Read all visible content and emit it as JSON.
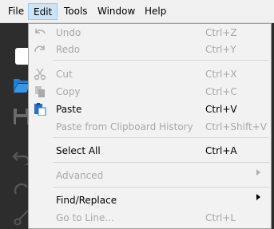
{
  "menubar": {
    "items": [
      {
        "label": "File"
      },
      {
        "label": "Edit"
      },
      {
        "label": "Tools"
      },
      {
        "label": "Window"
      },
      {
        "label": "Help"
      }
    ]
  },
  "edit_menu": {
    "items": [
      {
        "label": "Undo",
        "shortcut": "Ctrl+Z",
        "enabled": false,
        "icon": "undo-icon"
      },
      {
        "label": "Redo",
        "shortcut": "Ctrl+Y",
        "enabled": false,
        "icon": "redo-icon"
      },
      {
        "label": "Cut",
        "shortcut": "Ctrl+X",
        "enabled": false,
        "icon": "scissors-icon"
      },
      {
        "label": "Copy",
        "shortcut": "Ctrl+C",
        "enabled": false,
        "icon": "copy-icon"
      },
      {
        "label": "Paste",
        "shortcut": "Ctrl+V",
        "enabled": true,
        "icon": "paste-icon"
      },
      {
        "label": "Paste from Clipboard History",
        "shortcut": "Ctrl+Shift+V",
        "enabled": false
      },
      {
        "label": "Select All",
        "shortcut": "Ctrl+A",
        "enabled": true
      },
      {
        "label": "Advanced",
        "enabled": false,
        "submenu": true
      },
      {
        "label": "Find/Replace",
        "enabled": true,
        "submenu": true
      },
      {
        "label": "Go to Line...",
        "shortcut": "Ctrl+L",
        "enabled": false
      }
    ]
  },
  "colors": {
    "menubar_bg": "#f0f0f0",
    "active_menu_bg": "#cce4f7",
    "dropdown_bg": "#f2f2f2",
    "disabled_text": "#a8a8a8",
    "sidebar_bg": "#2d2d2d",
    "accent_blue": "#1e7fd4"
  }
}
